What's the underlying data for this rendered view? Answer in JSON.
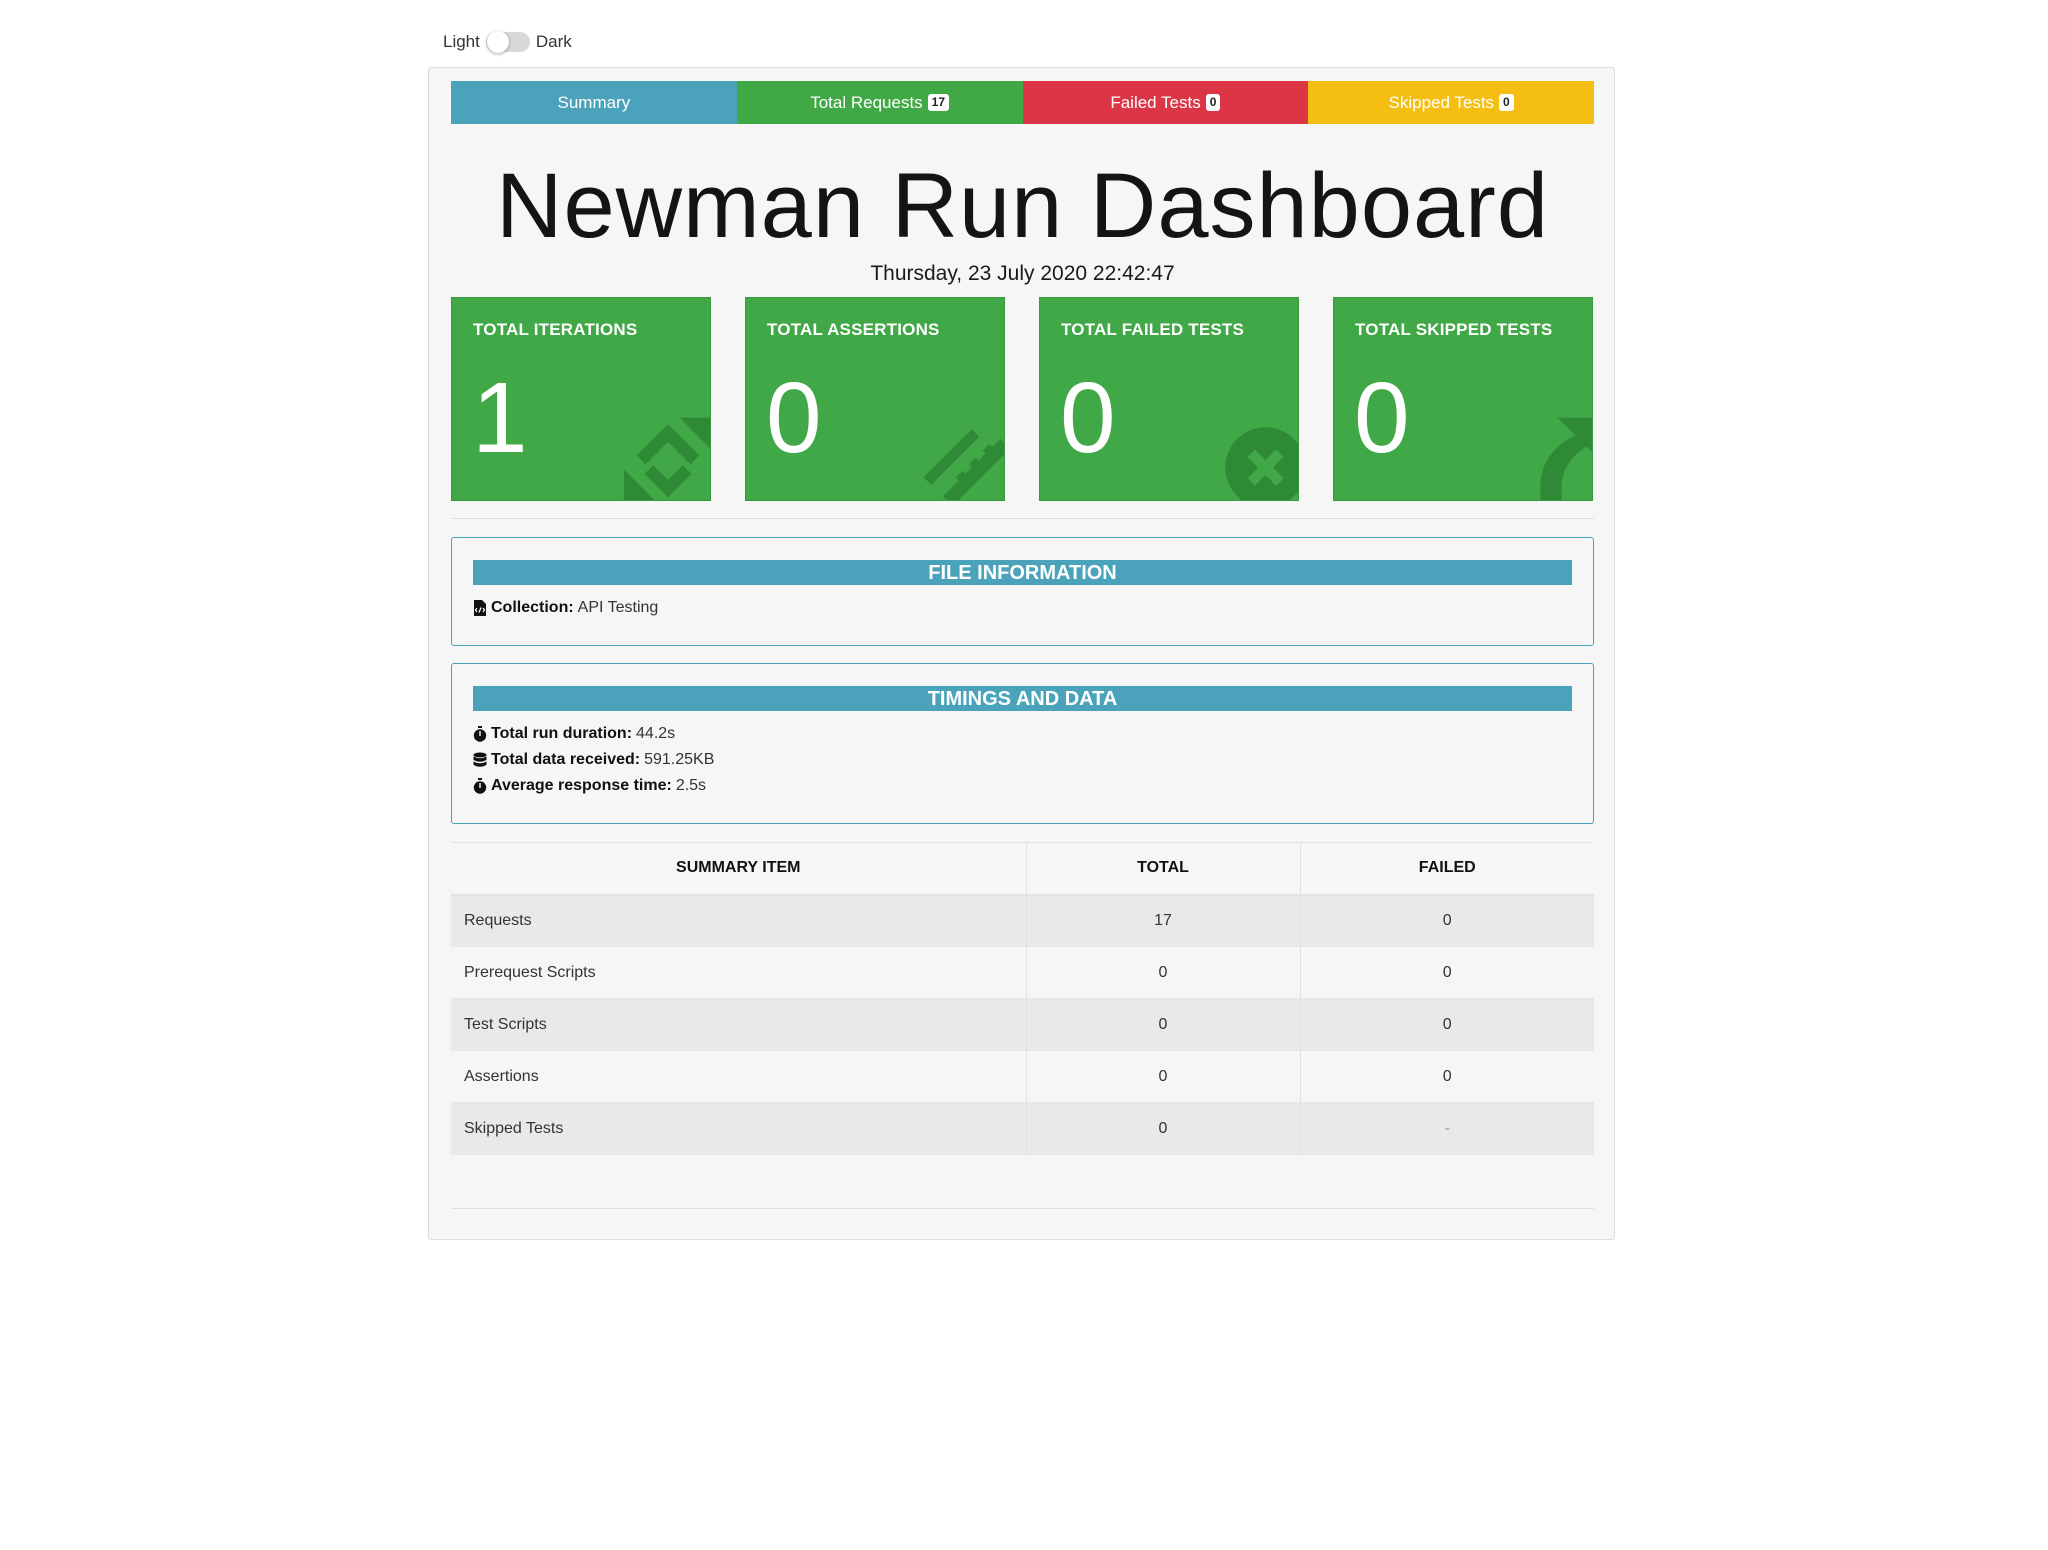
{
  "theme_switch": {
    "light_label": "Light",
    "dark_label": "Dark"
  },
  "tabs": [
    {
      "label": "Summary"
    },
    {
      "label": "Total Requests",
      "badge": "17"
    },
    {
      "label": "Failed Tests",
      "badge": "0"
    },
    {
      "label": "Skipped Tests",
      "badge": "0"
    }
  ],
  "header": {
    "title": "Newman Run Dashboard",
    "date": "Thursday, 23 July 2020 22:42:47"
  },
  "cards": [
    {
      "title": "TOTAL ITERATIONS",
      "value": "1",
      "icon": "sync-icon"
    },
    {
      "title": "TOTAL ASSERTIONS",
      "value": "0",
      "icon": "pencil-ruler-icon"
    },
    {
      "title": "TOTAL FAILED TESTS",
      "value": "0",
      "icon": "times-circle-icon"
    },
    {
      "title": "TOTAL SKIPPED TESTS",
      "value": "0",
      "icon": "share-arrow-icon"
    }
  ],
  "file_info": {
    "heading": "FILE INFORMATION",
    "collection_label": "Collection:",
    "collection_value": "API Testing"
  },
  "timings": {
    "heading": "TIMINGS AND DATA",
    "rows": [
      {
        "label": "Total run duration:",
        "value": "44.2s",
        "icon": "stopwatch-icon"
      },
      {
        "label": "Total data received:",
        "value": "591.25KB",
        "icon": "database-icon"
      },
      {
        "label": "Average response time:",
        "value": "2.5s",
        "icon": "stopwatch-icon"
      }
    ]
  },
  "summary_table": {
    "headers": [
      "SUMMARY ITEM",
      "TOTAL",
      "FAILED"
    ],
    "rows": [
      {
        "item": "Requests",
        "total": "17",
        "failed": "0"
      },
      {
        "item": "Prerequest Scripts",
        "total": "0",
        "failed": "0"
      },
      {
        "item": "Test Scripts",
        "total": "0",
        "failed": "0"
      },
      {
        "item": "Assertions",
        "total": "0",
        "failed": "0"
      },
      {
        "item": "Skipped Tests",
        "total": "0",
        "failed": "-"
      }
    ]
  },
  "colors": {
    "summary_tab": "#4aa3ba",
    "requests_tab": "#40a844",
    "failed_tab": "#dc3545",
    "skipped_tab": "#f4bf12",
    "card_green": "#41a847",
    "panel_accent": "#4aa3ba"
  }
}
